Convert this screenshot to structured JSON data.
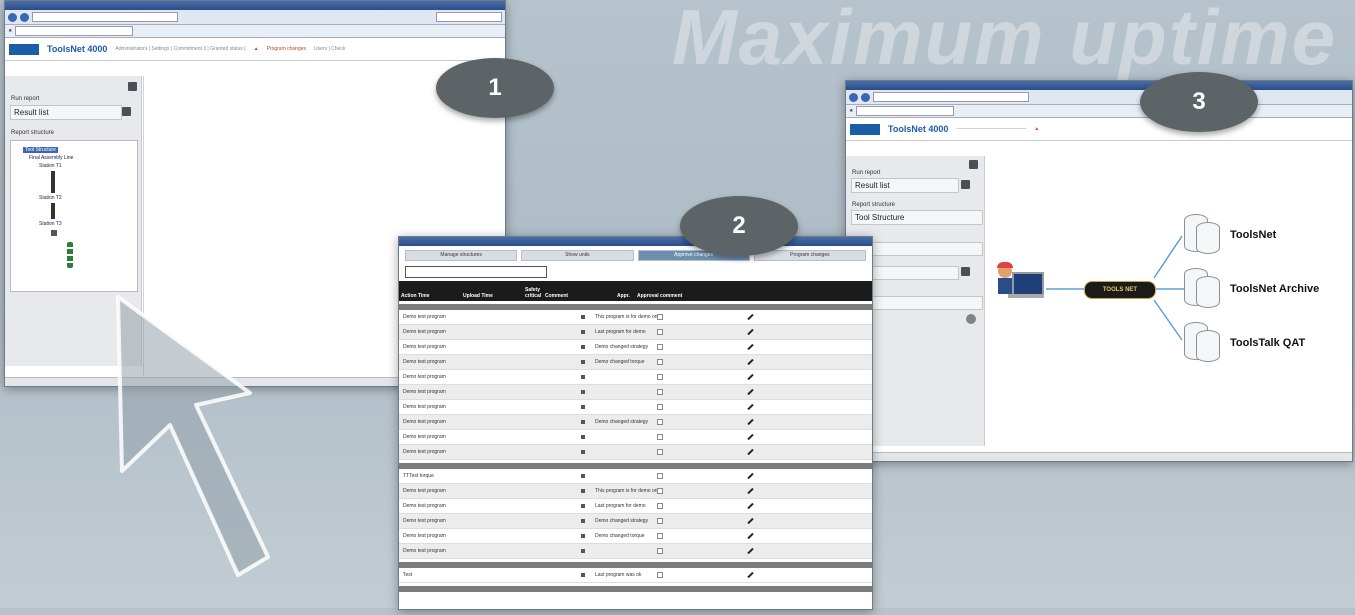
{
  "banner": "Maximum uptime",
  "badges": [
    "1",
    "2",
    "3"
  ],
  "colors": {
    "badge": "#5d6468",
    "brand": "#1a5ea8",
    "header": "#1b1b1b",
    "warn": "#cc4433"
  },
  "window1": {
    "app_title": "ToolsNet 4000",
    "nav": "Administrators | Settings | Commitment 3 | Granted status |",
    "warning": "Program changes",
    "nav_tail": "Users | Check",
    "run_report_label": "Run report",
    "run_report_value": "Result list",
    "report_structure_label": "Report structure",
    "tree": [
      "Tool Structure",
      "Final Assembly Line",
      "Station T1",
      "Station T2",
      "Station T3"
    ]
  },
  "window2": {
    "tabs": [
      "Manage structures",
      "Show units",
      "Approve changes",
      "Program changes"
    ],
    "headers": [
      "Action Time",
      "Upload Time",
      "Safety critical",
      "Comment",
      "Appr.",
      "Approval comment"
    ],
    "rows": [
      {
        "name": "Demo test program",
        "comment": "This program is for demo only"
      },
      {
        "name": "Demo test program",
        "comment": "Last program for demo"
      },
      {
        "name": "Demo test program",
        "comment": "Demo changed strategy"
      },
      {
        "name": "Demo test program",
        "comment": "Demo changed torque"
      },
      {
        "name": "Demo test program",
        "comment": ""
      },
      {
        "name": "Demo test program",
        "comment": ""
      },
      {
        "name": "Demo test program",
        "comment": ""
      },
      {
        "name": "Demo test program",
        "comment": "Demo changed strategy"
      },
      {
        "name": "Demo test program",
        "comment": ""
      },
      {
        "name": "Demo test program",
        "comment": ""
      }
    ],
    "rows2": [
      {
        "name": "TTTest torque",
        "comment": ""
      },
      {
        "name": "Demo test program",
        "comment": "This program is for demo only"
      },
      {
        "name": "Demo test program",
        "comment": "Last program for demo"
      },
      {
        "name": "Demo test program",
        "comment": "Demo changed strategy"
      },
      {
        "name": "Demo test program",
        "comment": "Demo changed torque"
      },
      {
        "name": "Demo test program",
        "comment": ""
      }
    ],
    "rows3": [
      {
        "name": "Test",
        "comment": "Last program was ok"
      }
    ]
  },
  "window3": {
    "app_title": "ToolsNet 4000",
    "run_report_label": "Run report",
    "run_report_value": "Result list",
    "report_structure_label": "Report structure",
    "report_structure_value": "Tool Structure",
    "hub_label": "TOOLS NET",
    "targets": [
      "ToolsNet",
      "ToolsNet Archive",
      "ToolsTalk QAT"
    ]
  }
}
